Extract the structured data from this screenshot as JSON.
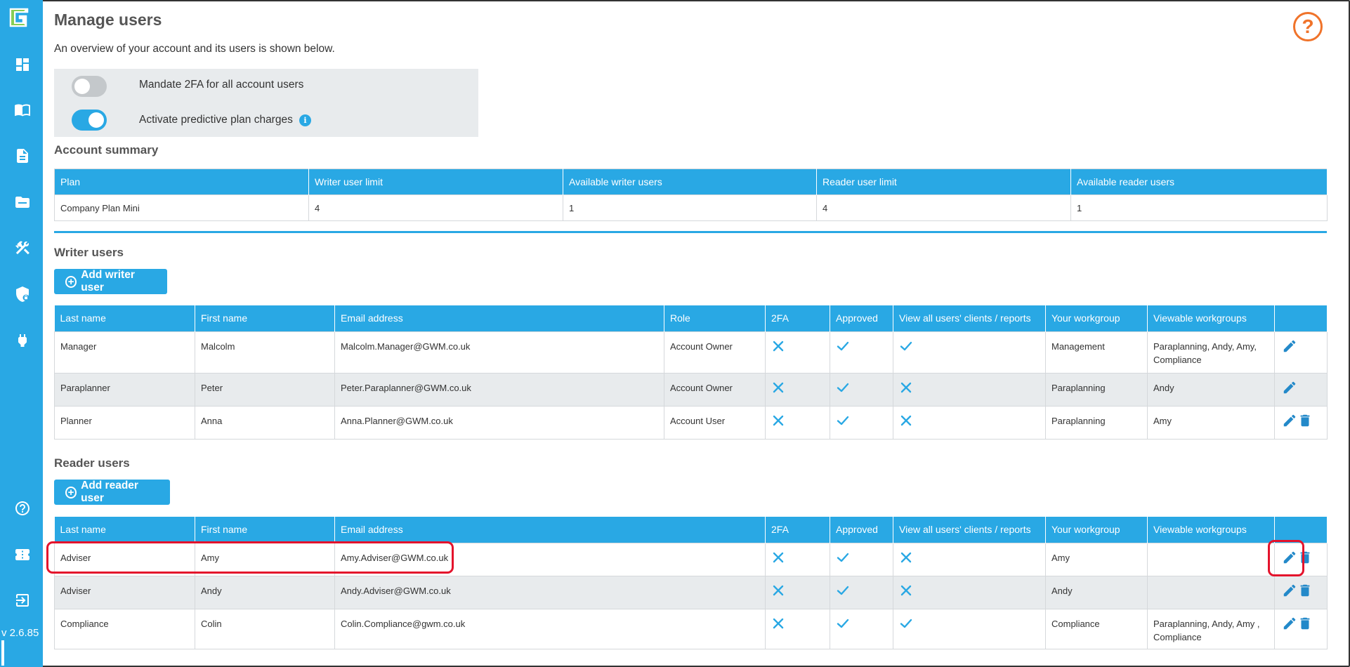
{
  "sidebar": {
    "logo_icon": "logo-icon",
    "items": [
      {
        "name": "dashboard-icon"
      },
      {
        "name": "book-icon"
      },
      {
        "name": "document-icon"
      },
      {
        "name": "folder-icon"
      },
      {
        "name": "tools-icon"
      },
      {
        "name": "shield-lock-icon"
      },
      {
        "name": "plug-icon"
      }
    ],
    "bottom_items": [
      {
        "name": "help-circle-icon"
      },
      {
        "name": "ticket-icon"
      },
      {
        "name": "logout-icon"
      }
    ],
    "version": "v 2.6.85"
  },
  "page": {
    "title": "Manage users",
    "subtitle": "An overview of your account and its users is shown below.",
    "help_label": "?"
  },
  "settings": {
    "mandate_2fa_label": "Mandate 2FA for all account users",
    "mandate_2fa_on": false,
    "predictive_label": "Activate predictive plan charges",
    "predictive_on": true,
    "info_label": "i"
  },
  "account_summary": {
    "title": "Account summary",
    "headers": [
      "Plan",
      "Writer user limit",
      "Available writer users",
      "Reader user limit",
      "Available reader users"
    ],
    "row": [
      "Company Plan Mini",
      "4",
      "1",
      "4",
      "1"
    ]
  },
  "writer_users": {
    "title": "Writer users",
    "add_label": "Add writer user",
    "headers": [
      "Last name",
      "First name",
      "Email address",
      "Role",
      "2FA",
      "Approved",
      "View all users' clients / reports",
      "Your workgroup",
      "Viewable workgroups",
      ""
    ],
    "rows": [
      {
        "last": "Manager",
        "first": "Malcolm",
        "email": "Malcolm.Manager@GWM.co.uk",
        "role": "Account Owner",
        "twofa": false,
        "approved": true,
        "view_all": true,
        "workgroup": "Management",
        "viewable": "Paraplanning, Andy, Amy, Compliance",
        "can_delete": false
      },
      {
        "last": "Paraplanner",
        "first": "Peter",
        "email": "Peter.Paraplanner@GWM.co.uk",
        "role": "Account Owner",
        "twofa": false,
        "approved": true,
        "view_all": false,
        "workgroup": "Paraplanning",
        "viewable": "Andy",
        "can_delete": false
      },
      {
        "last": "Planner",
        "first": "Anna",
        "email": "Anna.Planner@GWM.co.uk",
        "role": "Account User",
        "twofa": false,
        "approved": true,
        "view_all": false,
        "workgroup": "Paraplanning",
        "viewable": "Amy",
        "can_delete": true
      }
    ]
  },
  "reader_users": {
    "title": "Reader users",
    "add_label": "Add reader user",
    "headers": [
      "Last name",
      "First name",
      "Email address",
      "2FA",
      "Approved",
      "View all users' clients / reports",
      "Your workgroup",
      "Viewable workgroups",
      ""
    ],
    "rows": [
      {
        "last": "Adviser",
        "first": "Amy",
        "email": "Amy.Adviser@GWM.co.uk",
        "twofa": false,
        "approved": true,
        "view_all": false,
        "workgroup": "Amy",
        "viewable": "",
        "can_delete": true
      },
      {
        "last": "Adviser",
        "first": "Andy",
        "email": "Andy.Adviser@GWM.co.uk",
        "twofa": false,
        "approved": true,
        "view_all": false,
        "workgroup": "Andy",
        "viewable": "",
        "can_delete": true
      },
      {
        "last": "Compliance",
        "first": "Colin",
        "email": "Colin.Compliance@gwm.co.uk",
        "twofa": false,
        "approved": true,
        "view_all": true,
        "workgroup": "Compliance",
        "viewable": "Paraplanning, Andy, Amy , Compliance",
        "can_delete": true
      }
    ]
  },
  "colors": {
    "accent": "#29a8e4",
    "highlight": "#e4132c",
    "help": "#f0732a"
  }
}
